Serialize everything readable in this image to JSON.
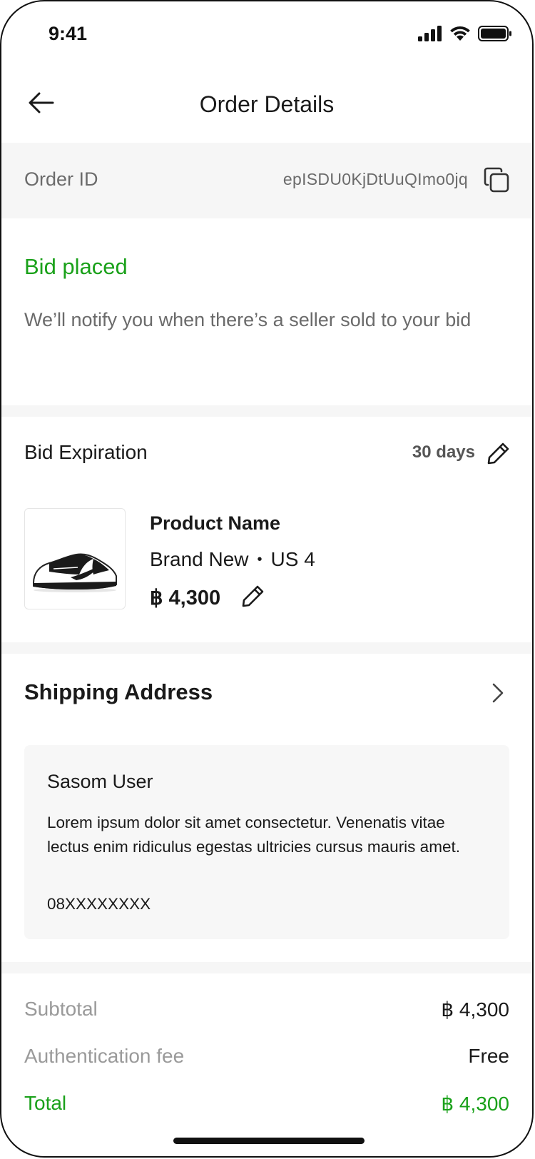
{
  "status_bar": {
    "time": "9:41",
    "icons": [
      "cellular-signal-icon",
      "wifi-icon",
      "battery-icon"
    ]
  },
  "header": {
    "title": "Order Details",
    "back_icon": "arrow-left-icon"
  },
  "order": {
    "id_label": "Order ID",
    "id_value": "epISDU0KjDtUuQImo0jq",
    "copy_icon": "copy-icon"
  },
  "status": {
    "title": "Bid placed",
    "note": "We’ll notify you when there’s a seller sold to your bid"
  },
  "bid": {
    "expiration_label": "Bid Expiration",
    "expiration_value": "30 days",
    "product_name": "Product Name",
    "condition": "Brand New",
    "separator": "•",
    "size": "US 4",
    "price": "฿ 4,300"
  },
  "shipping": {
    "title": "Shipping Address",
    "name": "Sasom User",
    "address": "Lorem ipsum dolor sit amet consectetur. Venenatis vitae lectus enim ridiculus egestas ultricies cursus mauris amet.",
    "phone": "08XXXXXXXX"
  },
  "summary": {
    "subtotal_label": "Subtotal",
    "subtotal_value": "฿ 4,300",
    "auth_fee_label": "Authentication fee",
    "auth_fee_value": "Free",
    "total_label": "Total",
    "total_value": "฿ 4,300"
  },
  "colors": {
    "accent_green": "#1aa11a",
    "muted_text": "#6b6b6b",
    "band_gray": "#f6f6f6"
  }
}
